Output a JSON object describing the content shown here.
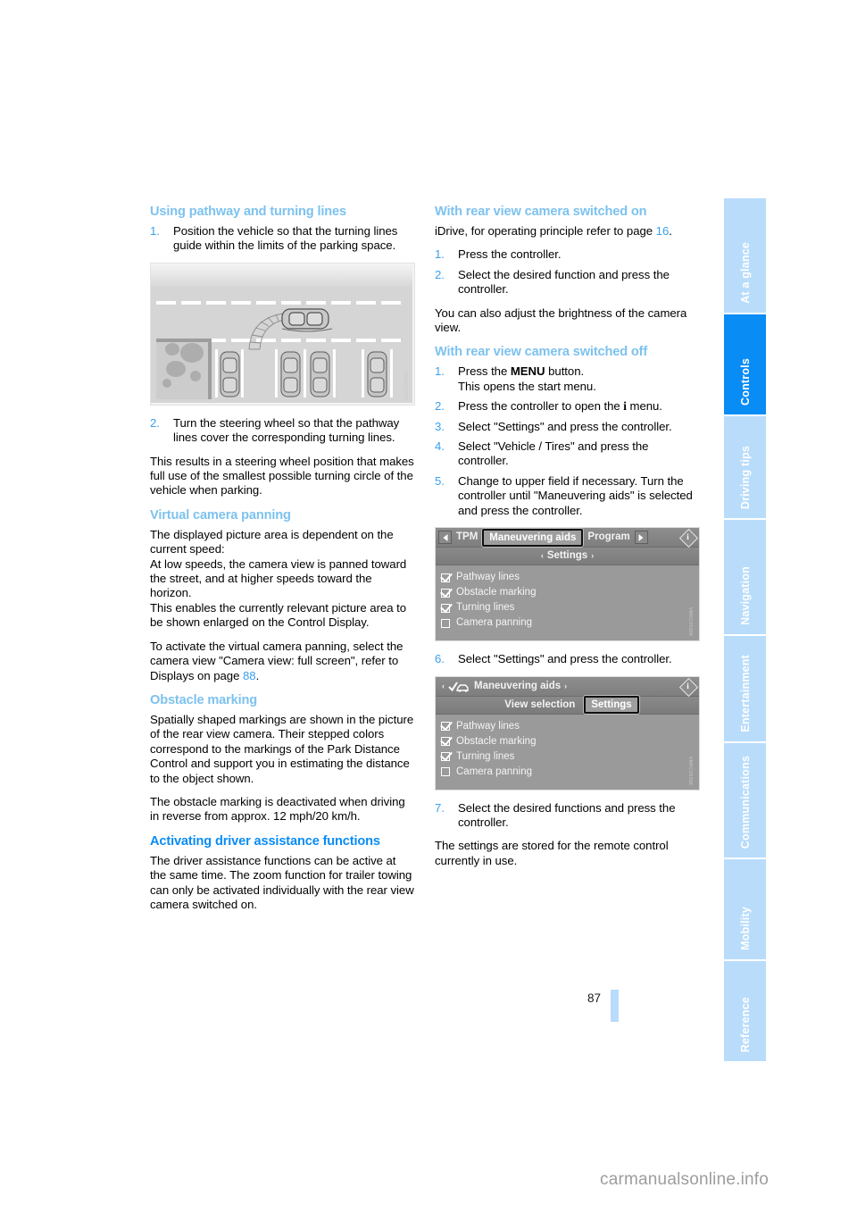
{
  "page": {
    "number": "87",
    "watermark": "carmanualsonline.info"
  },
  "tabs": [
    {
      "label": "At a glance",
      "active": false
    },
    {
      "label": "Controls",
      "active": true
    },
    {
      "label": "Driving tips",
      "active": false
    },
    {
      "label": "Navigation",
      "active": false
    },
    {
      "label": "Entertainment",
      "active": false
    },
    {
      "label": "Communications",
      "active": false
    },
    {
      "label": "Mobility",
      "active": false
    },
    {
      "label": "Reference",
      "active": false
    }
  ],
  "colors": {
    "heading_light": "#7dc2ee",
    "heading_strong": "#0a8cf5",
    "link": "#3aa0ee",
    "tab_inactive": "#b9dcfb",
    "tab_active": "#0a8cf5"
  },
  "left_column": {
    "heading_1": "Using pathway and turning lines",
    "step_1_num": "1.",
    "step_1_text": "Position the vehicle so that the turning lines guide within the limits of the parking space.",
    "figure_parking_code": "VMRC0535K",
    "step_2_num": "2.",
    "step_2_text": "Turn the steering wheel so that the pathway lines cover the corresponding turning lines.",
    "para_1": "This results in a steering wheel position that makes full use of the smallest possible turning circle of the vehicle when parking.",
    "heading_2": "Virtual camera panning",
    "para_2": "The displayed picture area is dependent on the current speed:",
    "para_3": "At low speeds, the camera view is panned toward the street, and at higher speeds toward the horizon.",
    "para_4": "This enables the currently relevant picture area to be shown enlarged on the Control Display.",
    "para_5_a": "To activate the virtual camera panning, select the camera view \"Camera view: full screen\", refer to Displays on page ",
    "para_5_ref": "88",
    "para_5_b": ".",
    "heading_3": "Obstacle marking",
    "para_6": "Spatially shaped markings are shown in the picture of the rear view camera. Their stepped colors correspond to the markings of the Park Distance Control and support you in estimating the distance to the object shown.",
    "para_7": "The obstacle marking is deactivated when driving in reverse from approx. 12 mph/20 km/h.",
    "heading_4": "Activating driver assistance functions",
    "para_8": "The driver assistance functions can be active at the same time. The zoom function for trailer towing can only be activated individually with the rear view camera switched on."
  },
  "right_column": {
    "heading_1": "With rear view camera switched on",
    "intro_a": "iDrive, for operating principle refer to page ",
    "intro_ref": "16",
    "intro_b": ".",
    "steps_on": [
      {
        "num": "1.",
        "text": "Press the controller."
      },
      {
        "num": "2.",
        "text": "Select the desired function and press the controller."
      }
    ],
    "para_1": "You can also adjust the brightness of the camera view.",
    "heading_2": "With rear view camera switched off",
    "step_1": {
      "num": "1.",
      "pre": "Press the ",
      "key": "MENU",
      "post": " button.",
      "line2": "This opens the start menu."
    },
    "step_2": {
      "num": "2.",
      "pre": "Press the controller to open the ",
      "key": "i",
      "post": " menu."
    },
    "step_3": {
      "num": "3.",
      "text": "Select \"Settings\" and press the controller."
    },
    "step_4": {
      "num": "4.",
      "text": "Select \"Vehicle / Tires\" and press the controller."
    },
    "step_5": {
      "num": "5.",
      "text": "Change to upper field if necessary. Turn the controller until \"Maneuvering aids\" is selected and press the controller."
    },
    "step_6": {
      "num": "6.",
      "text": "Select \"Settings\" and press the controller."
    },
    "step_7": {
      "num": "7.",
      "text": "Select the desired functions and press the controller."
    },
    "para_2": "The settings are stored for the remote control currently in use."
  },
  "idrive_screen_1": {
    "code": "VMRC0536K",
    "topbar": {
      "left_arrow": "left-arrow",
      "item_left": "TPM",
      "item_selected": "Maneuvering aids",
      "item_right": "Program",
      "right_arrow": "right-arrow",
      "info_glyph": "i"
    },
    "secondbar": {
      "left_caret": "‹",
      "label": "Settings",
      "right_caret": "›"
    },
    "options": [
      {
        "label": "Pathway lines",
        "checked": true
      },
      {
        "label": "Obstacle marking",
        "checked": true
      },
      {
        "label": "Turning lines",
        "checked": true
      },
      {
        "label": "Camera panning",
        "checked": false
      }
    ]
  },
  "idrive_screen_2": {
    "code": "VMRC0536K",
    "topbar": {
      "left_caret": "‹",
      "icon": "car-check-icon",
      "title": "Maneuvering aids",
      "right_caret": "›",
      "info_glyph": "i"
    },
    "secondbar": {
      "item_left": "View selection",
      "item_selected": "Settings"
    },
    "options": [
      {
        "label": "Pathway lines",
        "checked": true
      },
      {
        "label": "Obstacle marking",
        "checked": true
      },
      {
        "label": "Turning lines",
        "checked": true
      },
      {
        "label": "Camera panning",
        "checked": false
      }
    ]
  }
}
